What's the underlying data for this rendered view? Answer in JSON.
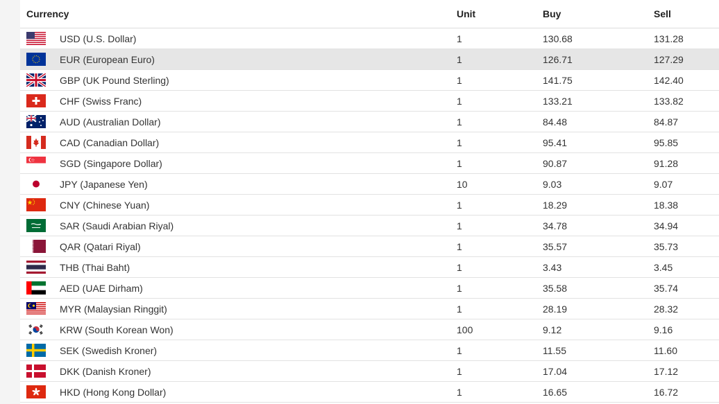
{
  "table": {
    "headers": {
      "currency": "Currency",
      "unit": "Unit",
      "buy": "Buy",
      "sell": "Sell"
    },
    "rows": [
      {
        "flag": "us-flag-icon",
        "currency": "USD (U.S. Dollar)",
        "unit": "1",
        "buy": "130.68",
        "sell": "131.28"
      },
      {
        "flag": "eu-flag-icon",
        "currency": "EUR (European Euro)",
        "unit": "1",
        "buy": "126.71",
        "sell": "127.29"
      },
      {
        "flag": "gb-flag-icon",
        "currency": "GBP (UK Pound Sterling)",
        "unit": "1",
        "buy": "141.75",
        "sell": "142.40"
      },
      {
        "flag": "ch-flag-icon",
        "currency": "CHF (Swiss Franc)",
        "unit": "1",
        "buy": "133.21",
        "sell": "133.82"
      },
      {
        "flag": "au-flag-icon",
        "currency": "AUD (Australian Dollar)",
        "unit": "1",
        "buy": "84.48",
        "sell": "84.87"
      },
      {
        "flag": "ca-flag-icon",
        "currency": "CAD (Canadian Dollar)",
        "unit": "1",
        "buy": "95.41",
        "sell": "95.85"
      },
      {
        "flag": "sg-flag-icon",
        "currency": "SGD (Singapore Dollar)",
        "unit": "1",
        "buy": "90.87",
        "sell": "91.28"
      },
      {
        "flag": "jp-flag-icon",
        "currency": "JPY (Japanese Yen)",
        "unit": "10",
        "buy": "9.03",
        "sell": "9.07"
      },
      {
        "flag": "cn-flag-icon",
        "currency": "CNY (Chinese Yuan)",
        "unit": "1",
        "buy": "18.29",
        "sell": "18.38"
      },
      {
        "flag": "sa-flag-icon",
        "currency": "SAR (Saudi Arabian Riyal)",
        "unit": "1",
        "buy": "34.78",
        "sell": "34.94"
      },
      {
        "flag": "qa-flag-icon",
        "currency": "QAR (Qatari Riyal)",
        "unit": "1",
        "buy": "35.57",
        "sell": "35.73"
      },
      {
        "flag": "th-flag-icon",
        "currency": "THB (Thai Baht)",
        "unit": "1",
        "buy": "3.43",
        "sell": "3.45"
      },
      {
        "flag": "ae-flag-icon",
        "currency": "AED (UAE Dirham)",
        "unit": "1",
        "buy": "35.58",
        "sell": "35.74"
      },
      {
        "flag": "my-flag-icon",
        "currency": "MYR (Malaysian Ringgit)",
        "unit": "1",
        "buy": "28.19",
        "sell": "28.32"
      },
      {
        "flag": "kr-flag-icon",
        "currency": "KRW (South Korean Won)",
        "unit": "100",
        "buy": "9.12",
        "sell": "9.16"
      },
      {
        "flag": "se-flag-icon",
        "currency": "SEK (Swedish Kroner)",
        "unit": "1",
        "buy": "11.55",
        "sell": "11.60"
      },
      {
        "flag": "dk-flag-icon",
        "currency": "DKK (Danish Kroner)",
        "unit": "1",
        "buy": "17.04",
        "sell": "17.12"
      },
      {
        "flag": "hk-flag-icon",
        "currency": "HKD (Hong Kong Dollar)",
        "unit": "1",
        "buy": "16.65",
        "sell": "16.72"
      }
    ]
  },
  "colors": {
    "highlight_row": "#e6e6e6",
    "border": "#e2e2e2"
  }
}
